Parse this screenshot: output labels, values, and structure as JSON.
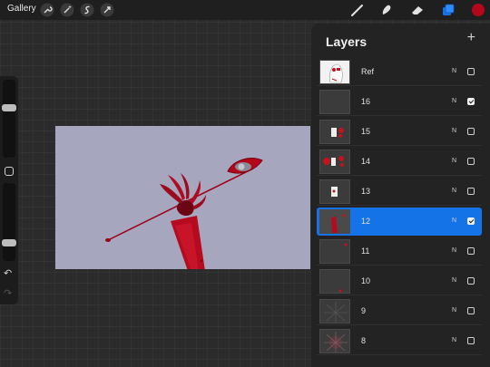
{
  "topbar": {
    "gallery_label": "Gallery",
    "left_tools": [
      "wrench-icon",
      "magic-wand-icon",
      "selection-icon",
      "transform-icon"
    ],
    "right_tools": [
      "brush-icon",
      "smudge-icon",
      "eraser-icon",
      "layers-icon",
      "color-icon"
    ],
    "accent_color": "#1473e6",
    "current_color": "#b5071b"
  },
  "sidebar": {
    "brush_size_level": 0.65,
    "opacity_level": 0.2,
    "undo_icon": "undo-icon",
    "redo_icon": "redo-icon"
  },
  "layers": {
    "title": "Layers",
    "add_icon": "plus-icon",
    "items": [
      {
        "name": "Ref",
        "blend": "N",
        "visible": false,
        "selected": false
      },
      {
        "name": "16",
        "blend": "N",
        "visible": true,
        "selected": false
      },
      {
        "name": "15",
        "blend": "N",
        "visible": false,
        "selected": false
      },
      {
        "name": "14",
        "blend": "N",
        "visible": false,
        "selected": false
      },
      {
        "name": "13",
        "blend": "N",
        "visible": false,
        "selected": false
      },
      {
        "name": "12",
        "blend": "N",
        "visible": true,
        "selected": true
      },
      {
        "name": "11",
        "blend": "N",
        "visible": false,
        "selected": false
      },
      {
        "name": "10",
        "blend": "N",
        "visible": false,
        "selected": false
      },
      {
        "name": "9",
        "blend": "N",
        "visible": false,
        "selected": false
      },
      {
        "name": "8",
        "blend": "N",
        "visible": false,
        "selected": false
      }
    ]
  }
}
